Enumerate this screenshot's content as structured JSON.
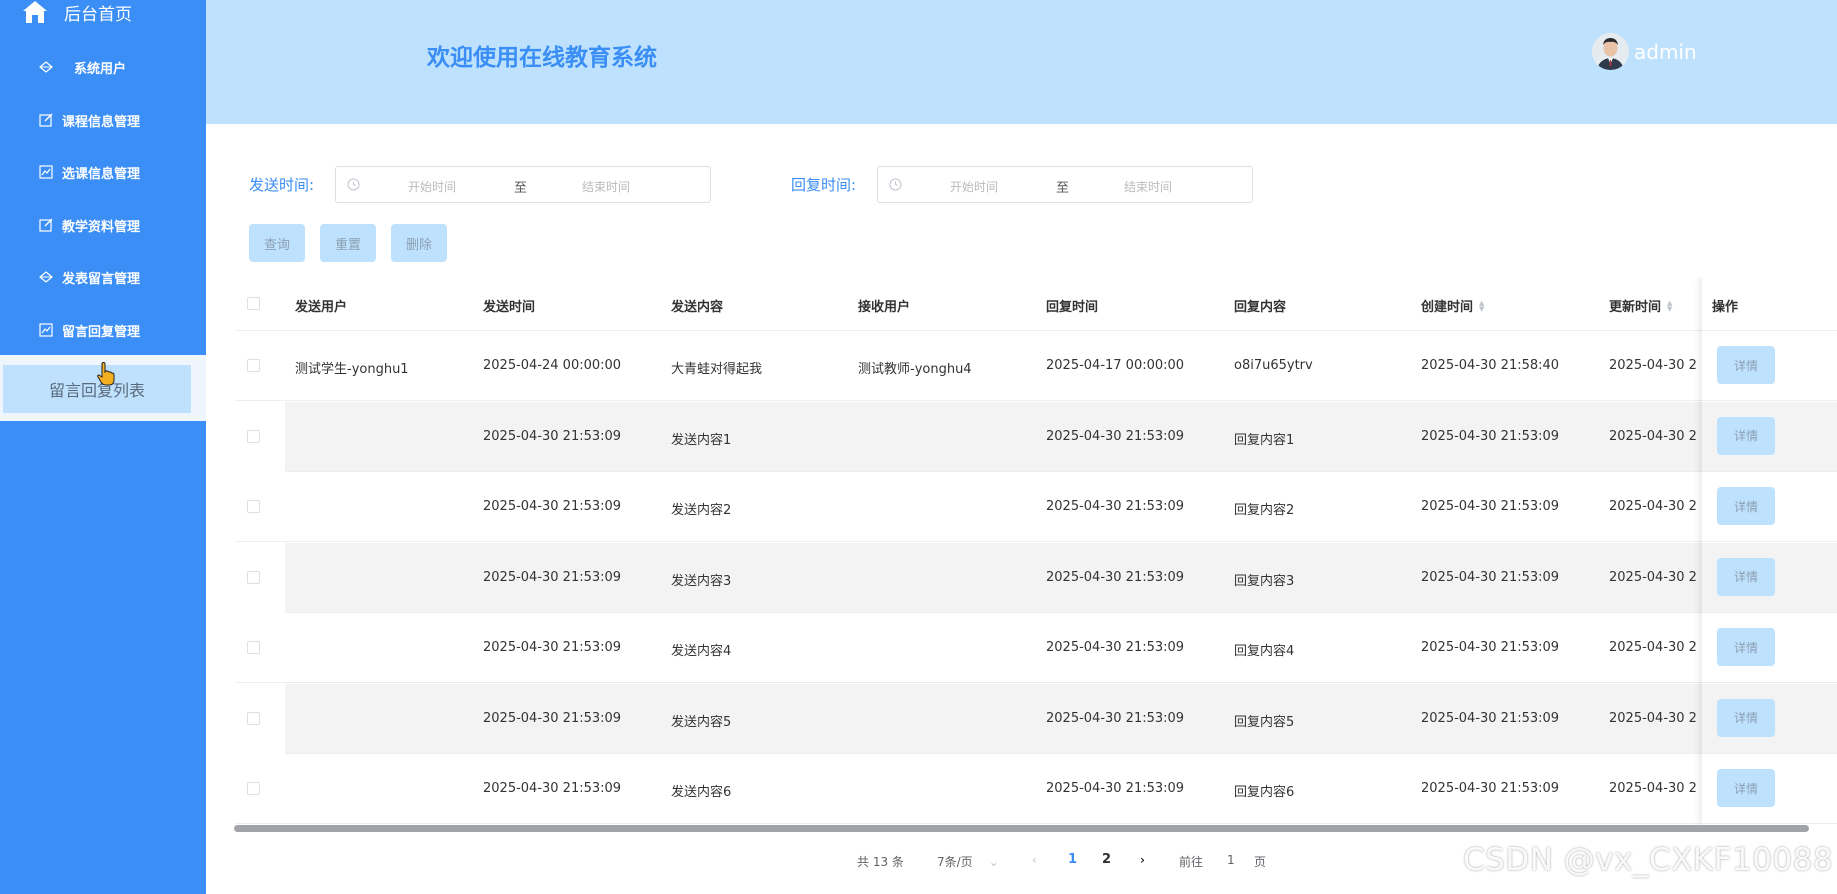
{
  "sidebar": {
    "home_label": "后台首页",
    "menu": [
      {
        "label": "系统用户",
        "icon": "diamond-icon"
      },
      {
        "label": "课程信息管理",
        "icon": "edit-icon"
      },
      {
        "label": "选课信息管理",
        "icon": "chart-icon"
      },
      {
        "label": "教学资料管理",
        "icon": "edit-icon"
      },
      {
        "label": "发表留言管理",
        "icon": "diamond-icon"
      },
      {
        "label": "留言回复管理",
        "icon": "chart-icon"
      }
    ],
    "active_submenu": "留言回复列表"
  },
  "header": {
    "title": "欢迎使用在线教育系统",
    "username": "admin"
  },
  "filters": {
    "send_time_label": "发送时间:",
    "reply_time_label": "回复时间:",
    "start_placeholder": "开始时间",
    "end_placeholder": "结束时间",
    "range_separator": "至"
  },
  "actions": {
    "query": "查询",
    "reset": "重置",
    "delete": "删除"
  },
  "table": {
    "columns": [
      "发送用户",
      "发送时间",
      "发送内容",
      "接收用户",
      "回复时间",
      "回复内容",
      "创建时间",
      "更新时间",
      "操作"
    ],
    "detail_label": "详情",
    "rows": [
      {
        "send_user": "测试学生-yonghu1",
        "send_time": "2025-04-24 00:00:00",
        "send_content": "大青蛙对得起我",
        "receiver": "测试教师-yonghu4",
        "reply_time": "2025-04-17 00:00:00",
        "reply_content": "o8i7u65ytrv",
        "created": "2025-04-30 21:58:40",
        "updated": "2025-04-30 2"
      },
      {
        "send_user": "",
        "send_time": "2025-04-30 21:53:09",
        "send_content": "发送内容1",
        "receiver": "",
        "reply_time": "2025-04-30 21:53:09",
        "reply_content": "回复内容1",
        "created": "2025-04-30 21:53:09",
        "updated": "2025-04-30 2"
      },
      {
        "send_user": "",
        "send_time": "2025-04-30 21:53:09",
        "send_content": "发送内容2",
        "receiver": "",
        "reply_time": "2025-04-30 21:53:09",
        "reply_content": "回复内容2",
        "created": "2025-04-30 21:53:09",
        "updated": "2025-04-30 2"
      },
      {
        "send_user": "",
        "send_time": "2025-04-30 21:53:09",
        "send_content": "发送内容3",
        "receiver": "",
        "reply_time": "2025-04-30 21:53:09",
        "reply_content": "回复内容3",
        "created": "2025-04-30 21:53:09",
        "updated": "2025-04-30 2"
      },
      {
        "send_user": "",
        "send_time": "2025-04-30 21:53:09",
        "send_content": "发送内容4",
        "receiver": "",
        "reply_time": "2025-04-30 21:53:09",
        "reply_content": "回复内容4",
        "created": "2025-04-30 21:53:09",
        "updated": "2025-04-30 2"
      },
      {
        "send_user": "",
        "send_time": "2025-04-30 21:53:09",
        "send_content": "发送内容5",
        "receiver": "",
        "reply_time": "2025-04-30 21:53:09",
        "reply_content": "回复内容5",
        "created": "2025-04-30 21:53:09",
        "updated": "2025-04-30 2"
      },
      {
        "send_user": "",
        "send_time": "2025-04-30 21:53:09",
        "send_content": "发送内容6",
        "receiver": "",
        "reply_time": "2025-04-30 21:53:09",
        "reply_content": "回复内容6",
        "created": "2025-04-30 21:53:09",
        "updated": "2025-04-30 2"
      }
    ]
  },
  "pagination": {
    "total": "共 13 条",
    "page_size": "7条/页",
    "pages": [
      "1",
      "2"
    ],
    "current_page": "1",
    "goto_prefix": "前往",
    "goto_value": "1",
    "goto_suffix": "页"
  },
  "watermark": "CSDN @vx_CXKF10088",
  "colors": {
    "sidebar": "#3a8ef6",
    "header": "#bee2fd",
    "accent": "#3a8ef6",
    "button": "#bee2fd"
  }
}
